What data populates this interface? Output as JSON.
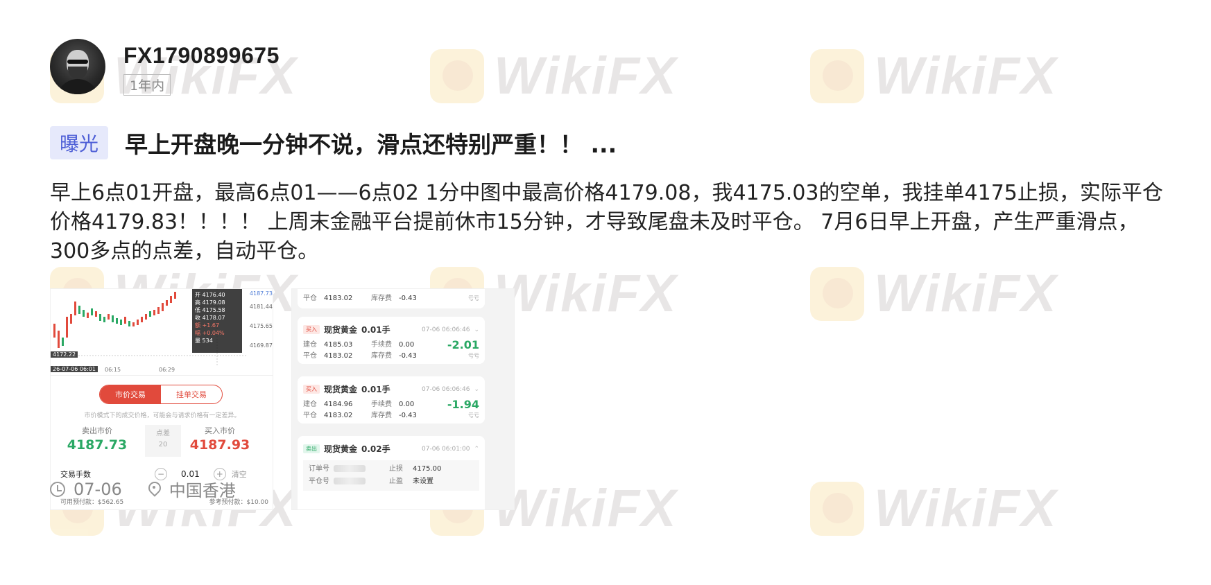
{
  "watermark": {
    "text": "WikiFX"
  },
  "author": {
    "name": "FX1790899675",
    "period": "1年内"
  },
  "post": {
    "tag": "曝光",
    "title": "早上开盘晚一分钟不说，滑点还特别严重！！ ...",
    "content": "早上6点01开盘，最高6点01——6点02 1分中图中最高价格4179.08，我4175.03的空单，我挂单4175止损，实际平仓价格4179.83！！！！ 上周末金融平台提前休市15分钟，才导致尾盘未及时平仓。 7月6日早上开盘，产生严重滑点，300多点的点差，自动平仓。",
    "date": "07-06",
    "location": "中国香港"
  },
  "screenshot1": {
    "tooltip": [
      "开 4176.40",
      "高 4179.08",
      "低 4175.58",
      "收 4178.07",
      "额 +1.67",
      "幅 +0.04%",
      "量 534"
    ],
    "price_scale": [
      "4187.73",
      "4181.44",
      "4175.65",
      "4169.87"
    ],
    "left_label": "4172.22",
    "cursor_time": "26-07-06 06:01",
    "x_ticks": [
      "06:15",
      "06:29"
    ],
    "tabs": {
      "market": "市价交易",
      "pending": "挂单交易"
    },
    "hint": "市价模式下的成交价格，可能会与请求价格有一定差异。",
    "sell_label": "卖出市价",
    "sell_price": "4187.73",
    "spread_label": "点差",
    "spread_value": "20",
    "buy_label": "买入市价",
    "buy_price": "4187.93",
    "lots_label": "交易手数",
    "lots_value": "0.01",
    "clear_label": "清空",
    "available": "可用预付款：$562.65",
    "reference": "参考预付款：$10.00"
  },
  "screenshot2": {
    "top_close_label": "平仓",
    "top_close_price": "4183.02",
    "top_storage_label": "库存费",
    "top_storage": "-0.43",
    "top_pl_sub": "亏亏",
    "orders": [
      {
        "side": "买入",
        "name": "现货黄金",
        "lots": "0.01手",
        "time": "07-06 06:06:46",
        "open_label": "建仓",
        "open": "4185.03",
        "fee_label": "手续费",
        "fee": "0.00",
        "close_label": "平仓",
        "close": "4183.02",
        "storage_label": "库存费",
        "storage": "-0.43",
        "pl": "-2.01",
        "pl_sub": "亏亏"
      },
      {
        "side": "买入",
        "name": "现货黄金",
        "lots": "0.01手",
        "time": "07-06 06:06:46",
        "open_label": "建仓",
        "open": "4184.96",
        "fee_label": "手续费",
        "fee": "0.00",
        "close_label": "平仓",
        "close": "4183.02",
        "storage_label": "库存费",
        "storage": "-0.43",
        "pl": "-1.94",
        "pl_sub": "亏亏"
      }
    ],
    "sell_order": {
      "side": "卖出",
      "name": "现货黄金",
      "lots": "0.02手",
      "time": "07-06 06:01:00",
      "order_no_label": "订单号",
      "stop_loss_label": "止损",
      "stop_loss": "4175.00",
      "close_no_label": "平仓号",
      "take_profit_label": "止盈",
      "take_profit": "未设置"
    }
  }
}
